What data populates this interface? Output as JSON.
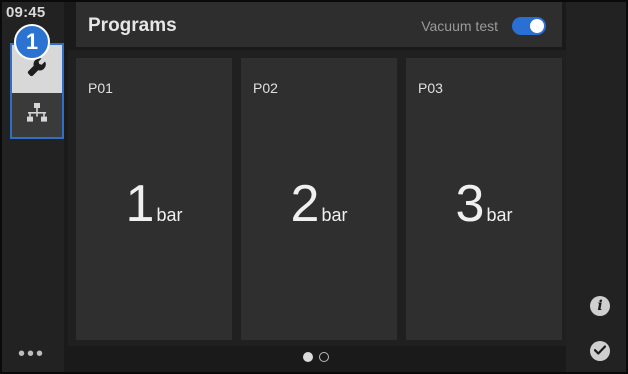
{
  "status": {
    "time": "09:45"
  },
  "annotation": {
    "badge_number": "1"
  },
  "header": {
    "title": "Programs",
    "vacuum_label": "Vacuum test",
    "vacuum_enabled": true
  },
  "programs": [
    {
      "name": "P01",
      "value": "1",
      "unit": "bar"
    },
    {
      "name": "P02",
      "value": "2",
      "unit": "bar"
    },
    {
      "name": "P03",
      "value": "3",
      "unit": "bar"
    }
  ],
  "pager": {
    "current_page": 1,
    "total_pages": 2
  },
  "more_label": "•••",
  "icons": {
    "tools": "wrench-icon",
    "network": "network-icon",
    "info": "info-icon",
    "confirm": "check-icon"
  },
  "colors": {
    "accent": "#2b72d1",
    "toggle_on": "#2a6fd4"
  }
}
